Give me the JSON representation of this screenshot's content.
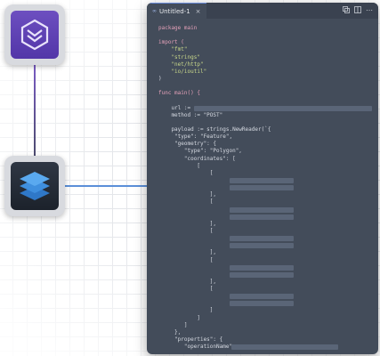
{
  "editor": {
    "tab_icon": "∞",
    "tab_title": "Untitled-1",
    "tab_close": "×",
    "lines": [
      {
        "t": "package main",
        "k": "kw-first"
      },
      {
        "t": ""
      },
      {
        "t": "import (",
        "k": "kw-first"
      },
      {
        "t": "    \"fmt\"",
        "k": "str"
      },
      {
        "t": "    \"strings\"",
        "k": "str"
      },
      {
        "t": "    \"net/http\"",
        "k": "str"
      },
      {
        "t": "    \"io/ioutil\"",
        "k": "str"
      },
      {
        "t": ")"
      },
      {
        "t": ""
      },
      {
        "t": "func main() {",
        "k": "kw-first"
      },
      {
        "t": ""
      },
      {
        "t": "    url := "
      },
      {
        "t": "    method := \"POST\""
      },
      {
        "t": ""
      },
      {
        "t": "    payload := strings.NewReader(`{"
      },
      {
        "t": "     \"type\": \"Feature\","
      },
      {
        "t": "     \"geometry\": {"
      },
      {
        "t": "        \"type\": \"Polygon\","
      },
      {
        "t": "        \"coordinates\": ["
      },
      {
        "t": "            ["
      },
      {
        "t": "                ["
      },
      {
        "t": ""
      },
      {
        "t": ""
      },
      {
        "t": "                ],"
      },
      {
        "t": "                ["
      },
      {
        "t": ""
      },
      {
        "t": ""
      },
      {
        "t": "                ],"
      },
      {
        "t": "                ["
      },
      {
        "t": ""
      },
      {
        "t": ""
      },
      {
        "t": "                ],"
      },
      {
        "t": "                ["
      },
      {
        "t": ""
      },
      {
        "t": ""
      },
      {
        "t": "                ],"
      },
      {
        "t": "                ["
      },
      {
        "t": ""
      },
      {
        "t": ""
      },
      {
        "t": "                ]"
      },
      {
        "t": "            ]"
      },
      {
        "t": "        ]"
      },
      {
        "t": "     },"
      },
      {
        "t": "     \"properties\": {"
      },
      {
        "t": "        \"operationName\":"
      }
    ]
  }
}
